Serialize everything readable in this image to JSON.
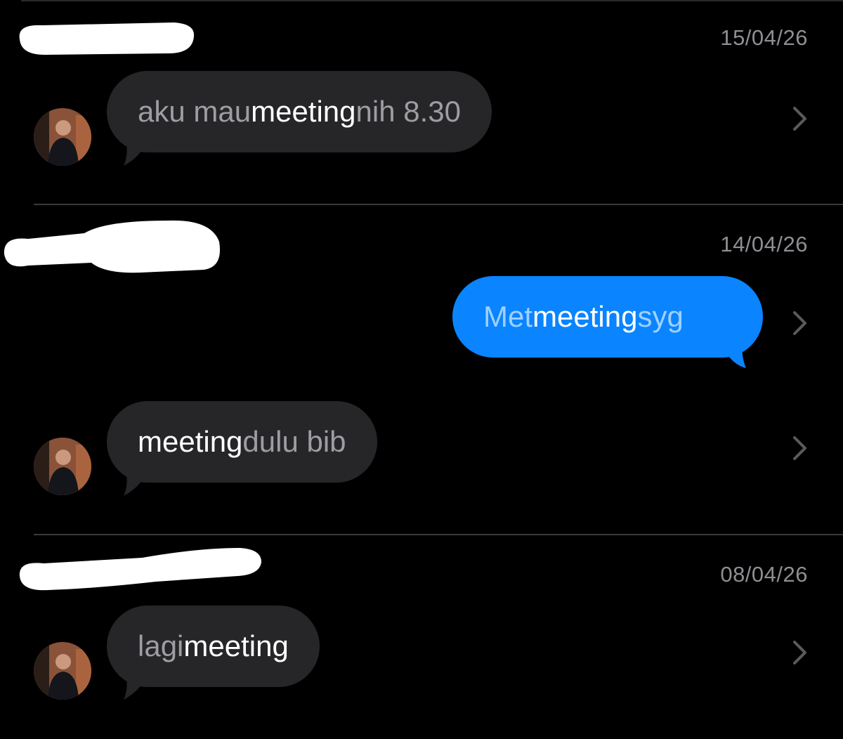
{
  "results": [
    {
      "date": "15/04/26",
      "messages": [
        {
          "direction": "incoming",
          "parts": [
            {
              "text": "aku mau ",
              "highlight": false
            },
            {
              "text": "meeting",
              "highlight": true
            },
            {
              "text": " nih 8.30",
              "highlight": false
            }
          ]
        }
      ]
    },
    {
      "date": "14/04/26",
      "messages": [
        {
          "direction": "outgoing",
          "parts": [
            {
              "text": "Met ",
              "highlight": false
            },
            {
              "text": "meeting",
              "highlight": true
            },
            {
              "text": " syg",
              "highlight": false
            }
          ]
        },
        {
          "direction": "incoming",
          "parts": [
            {
              "text": "meeting",
              "highlight": true
            },
            {
              "text": " dulu bib",
              "highlight": false
            }
          ]
        }
      ]
    },
    {
      "date": "08/04/26",
      "messages": [
        {
          "direction": "incoming",
          "parts": [
            {
              "text": "lagi ",
              "highlight": false
            },
            {
              "text": "meeting",
              "highlight": true
            }
          ]
        }
      ]
    }
  ],
  "icons": {
    "open_result": "chevron-right-icon",
    "contact_avatar": "avatar"
  },
  "colors": {
    "background": "#000000",
    "incoming_bubble": "#262628",
    "outgoing_bubble": "#0a84ff",
    "match_text": "#ffffff",
    "secondary_text": "#8e8e93"
  }
}
